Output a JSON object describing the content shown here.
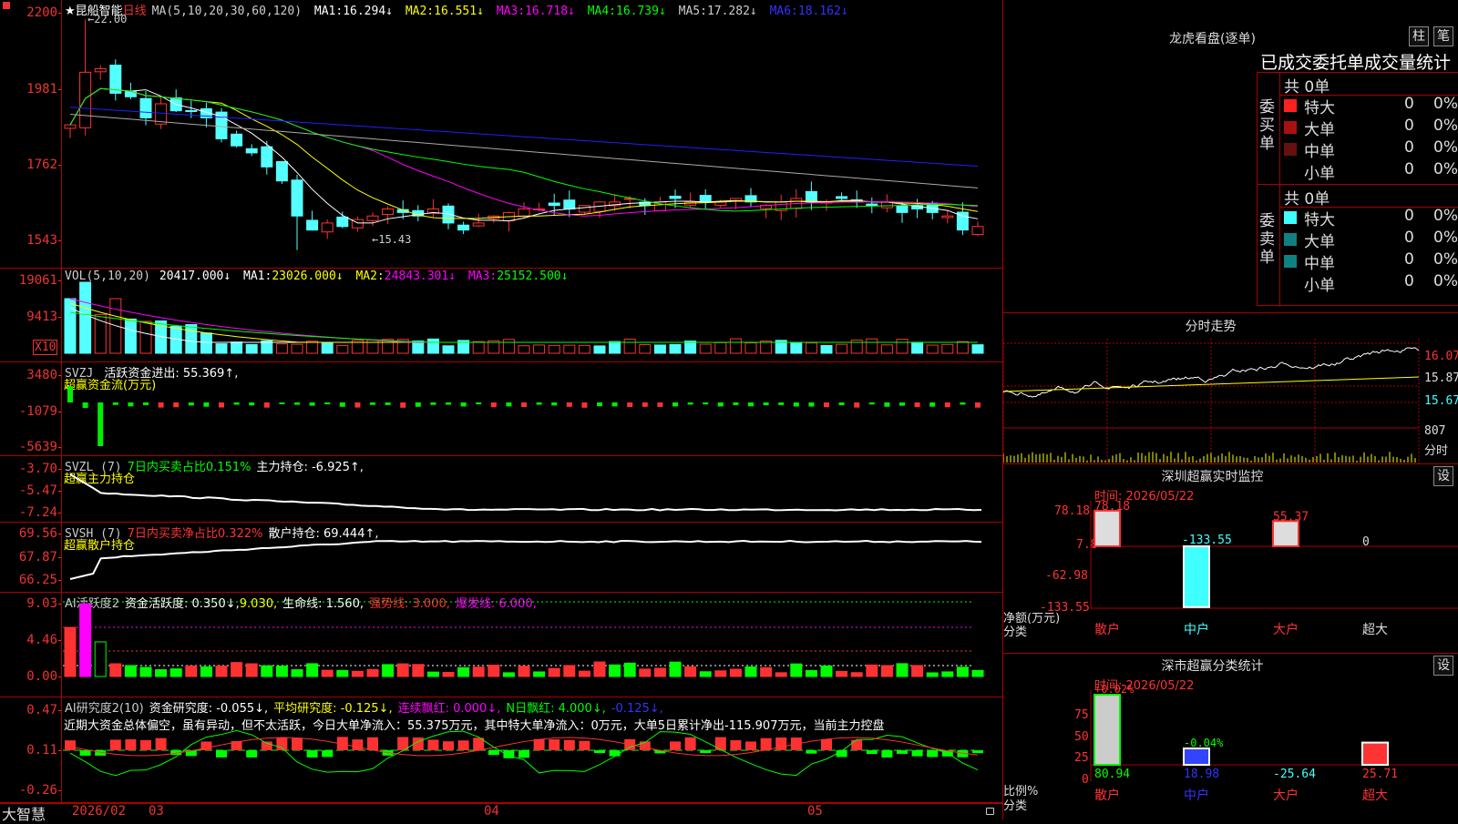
{
  "colors": {
    "up": "#ff3232",
    "down": "#54ffff",
    "ma1": "#ffffff",
    "ma2": "#ffff00",
    "ma3": "#ff00ff",
    "ma4": "#00ff00",
    "ma5": "#aaaaaa",
    "ma6": "#2020ff"
  },
  "price": {
    "stock": "★昆船智能",
    "period": "日线",
    "ma_label": "MA(5,10,20,30,60,120)",
    "ma": [
      {
        "k": "MA1:",
        "v": "16.294↓"
      },
      {
        "k": "MA2:",
        "v": "16.551↓"
      },
      {
        "k": "MA3:",
        "v": "16.718↓"
      },
      {
        "k": "MA4:",
        "v": "16.739↓"
      },
      {
        "k": "MA5:",
        "v": "17.282↓"
      },
      {
        "k": "MA6:",
        "v": "18.162↓"
      }
    ],
    "ticks": [
      "2200",
      "1981",
      "1762",
      "1543"
    ],
    "high_note": "←22.00",
    "low_note": "←15.43"
  },
  "vol": {
    "label": "VOL(5,10,20)",
    "value": "20417.000↓",
    "ma": [
      {
        "k": "MA1:",
        "v": "23026.000↓"
      },
      {
        "k": "MA2:",
        "v": "24843.301↓"
      },
      {
        "k": "MA3:",
        "v": "25152.500↓"
      }
    ],
    "ticks": [
      "19061",
      "9413"
    ],
    "unit": "X10"
  },
  "svzj": {
    "label": "SVZJ",
    "metric": "活跃资金进出: 55.369↑,",
    "sub": "超赢资金流(万元)",
    "ticks": [
      "3480",
      "-1079",
      "-5639"
    ]
  },
  "svzl": {
    "label": "SVZL (7)",
    "metric1": "7日内买卖占比0.151%",
    "metric2": "主力持仓: -6.925↑,",
    "sub": "超赢主力持仓",
    "ticks": [
      "-3.70",
      "-5.47",
      "-7.24"
    ]
  },
  "svsh": {
    "label": "SVSH (7)",
    "metric1": "7日内买卖净占比0.322%",
    "metric2": "散户持仓: 69.444↑,",
    "sub": "超赢散户持仓",
    "ticks": [
      "69.56",
      "67.87",
      "66.25"
    ]
  },
  "aih": {
    "label": "AI活跃度2",
    "m1": "资金活跃度: 0.350↓,",
    "m2": "9.030,",
    "m3": "生命线: 1.560,",
    "m4": "强势线: 3.000,",
    "m5": "爆发线: 6.000,",
    "ticks": [
      "9.03",
      "4.46",
      "0.00"
    ]
  },
  "aiy": {
    "label": "AI研究度2(10)",
    "m1": "资金研究度: -0.055↓,",
    "m2": "平均研究度: -0.125↓,",
    "m3": "连续飘红: 0.000↓,",
    "m4": "N日飘红: 4.000↓,",
    "m5": "-0.125↓,",
    "desc": "近期大资金总体偏空，虽有异动，但不太活跃，今日大单净流入：55.375万元，其中特大单净流入：0万元，大单5日累计净出-115.907万元，当前主力控盘",
    "ticks": [
      "0.47",
      "0.11",
      "-0.26"
    ]
  },
  "footer": {
    "brand": "大智慧",
    "d1": "2026/02",
    "d2": "03",
    "d3": "04",
    "d4": "05"
  },
  "lhb": {
    "title": "龙虎看盘(逐单)",
    "btn1": "柱",
    "btn2": "笔",
    "header": "已成交委托单成交量统计",
    "buy_label": "委买单",
    "sell_label": "委卖单",
    "buy_total": "共 0单",
    "sell_total": "共 0单",
    "buy_rows": [
      {
        "name": "特大",
        "v": "0",
        "p": "0%",
        "c": "#ff2020"
      },
      {
        "name": "大单",
        "v": "0",
        "p": "0%",
        "c": "#aa1010"
      },
      {
        "name": "中单",
        "v": "0",
        "p": "0%",
        "c": "#661010"
      },
      {
        "name": "小单",
        "v": "0",
        "p": "0%",
        "c": ""
      }
    ],
    "sell_rows": [
      {
        "name": "特大",
        "v": "0",
        "p": "0%",
        "c": "#40ffff"
      },
      {
        "name": "大单",
        "v": "0",
        "p": "0%",
        "c": "#108080"
      },
      {
        "name": "中单",
        "v": "0",
        "p": "0%",
        "c": "#108080"
      },
      {
        "name": "小单",
        "v": "0",
        "p": "0%",
        "c": ""
      }
    ]
  },
  "fenshi": {
    "title": "分时走势",
    "p1": "16.07",
    "p2": "15.87",
    "p3": "15.67",
    "v1": "807",
    "unit": "分时"
  },
  "szm": {
    "title": "深圳超赢实时监控",
    "btn": "设",
    "time": "时间: 2026/05/22",
    "ticks": [
      "78.18",
      "7.8",
      "-62.98",
      "-133.55"
    ],
    "yunit": "净额(万元)",
    "xunit": "分类",
    "values": [
      78.18,
      -133.55,
      55.37,
      0
    ],
    "vlabels": [
      "78.18",
      "-133.55",
      "55.37",
      "0"
    ],
    "cats": [
      "散户",
      "中户",
      "大户",
      "超大"
    ]
  },
  "szf": {
    "title": "深市超赢分类统计",
    "btn": "设",
    "time": "时间: 2026/05/22",
    "ticks": [
      "75",
      "50",
      "25",
      "0"
    ],
    "yunit": "比例%",
    "xunit": "分类",
    "values": [
      80.94,
      18.98,
      -25.64,
      25.71
    ],
    "top": [
      "+0.02%",
      "-0.04%",
      "",
      ""
    ],
    "vlabels": [
      "80.94",
      "18.98",
      "-25.64",
      "25.71"
    ],
    "cats": [
      "散户",
      "中户",
      "大户",
      "超大"
    ]
  }
}
